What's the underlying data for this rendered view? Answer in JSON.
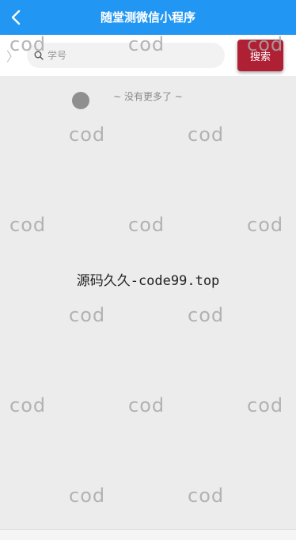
{
  "header": {
    "title": "随堂测微信小程序",
    "back_icon": "chevron-left-icon",
    "background_color": "#2196f3"
  },
  "search": {
    "placeholder": "学号",
    "value": "",
    "button_label": "搜索",
    "button_color": "#b02035",
    "icon": "search-icon"
  },
  "list": {
    "end_text": "~ 没有更多了 ~"
  },
  "watermark": {
    "text": "cod",
    "center_text": "源码久久-code99.top"
  }
}
